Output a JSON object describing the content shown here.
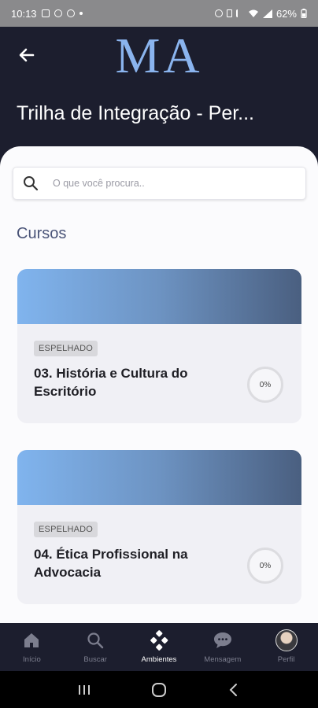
{
  "status_bar": {
    "time": "10:13",
    "battery": "62%"
  },
  "header": {
    "logo": "MA",
    "title": "Trilha de Integração - Per..."
  },
  "search": {
    "placeholder": "O que você procura.."
  },
  "section": {
    "title": "Cursos"
  },
  "courses": [
    {
      "badge": "ESPELHADO",
      "title": "03. História e Cultura do Escritório",
      "progress": "0%"
    },
    {
      "badge": "ESPELHADO",
      "title": "04. Ética Profissional na Advocacia",
      "progress": "0%"
    }
  ],
  "nav": [
    {
      "label": "Início",
      "icon": "home-icon"
    },
    {
      "label": "Buscar",
      "icon": "search-icon"
    },
    {
      "label": "Ambientes",
      "icon": "diamond-grid-icon",
      "active": true
    },
    {
      "label": "Mensagem",
      "icon": "chat-icon"
    },
    {
      "label": "Perfil",
      "icon": "avatar"
    }
  ],
  "colors": {
    "header_bg": "#1c1e2e",
    "logo": "#8ab4ee",
    "section_title": "#4a5478",
    "card_gradient_start": "#80b4ee",
    "card_gradient_end": "#4a5f80"
  }
}
